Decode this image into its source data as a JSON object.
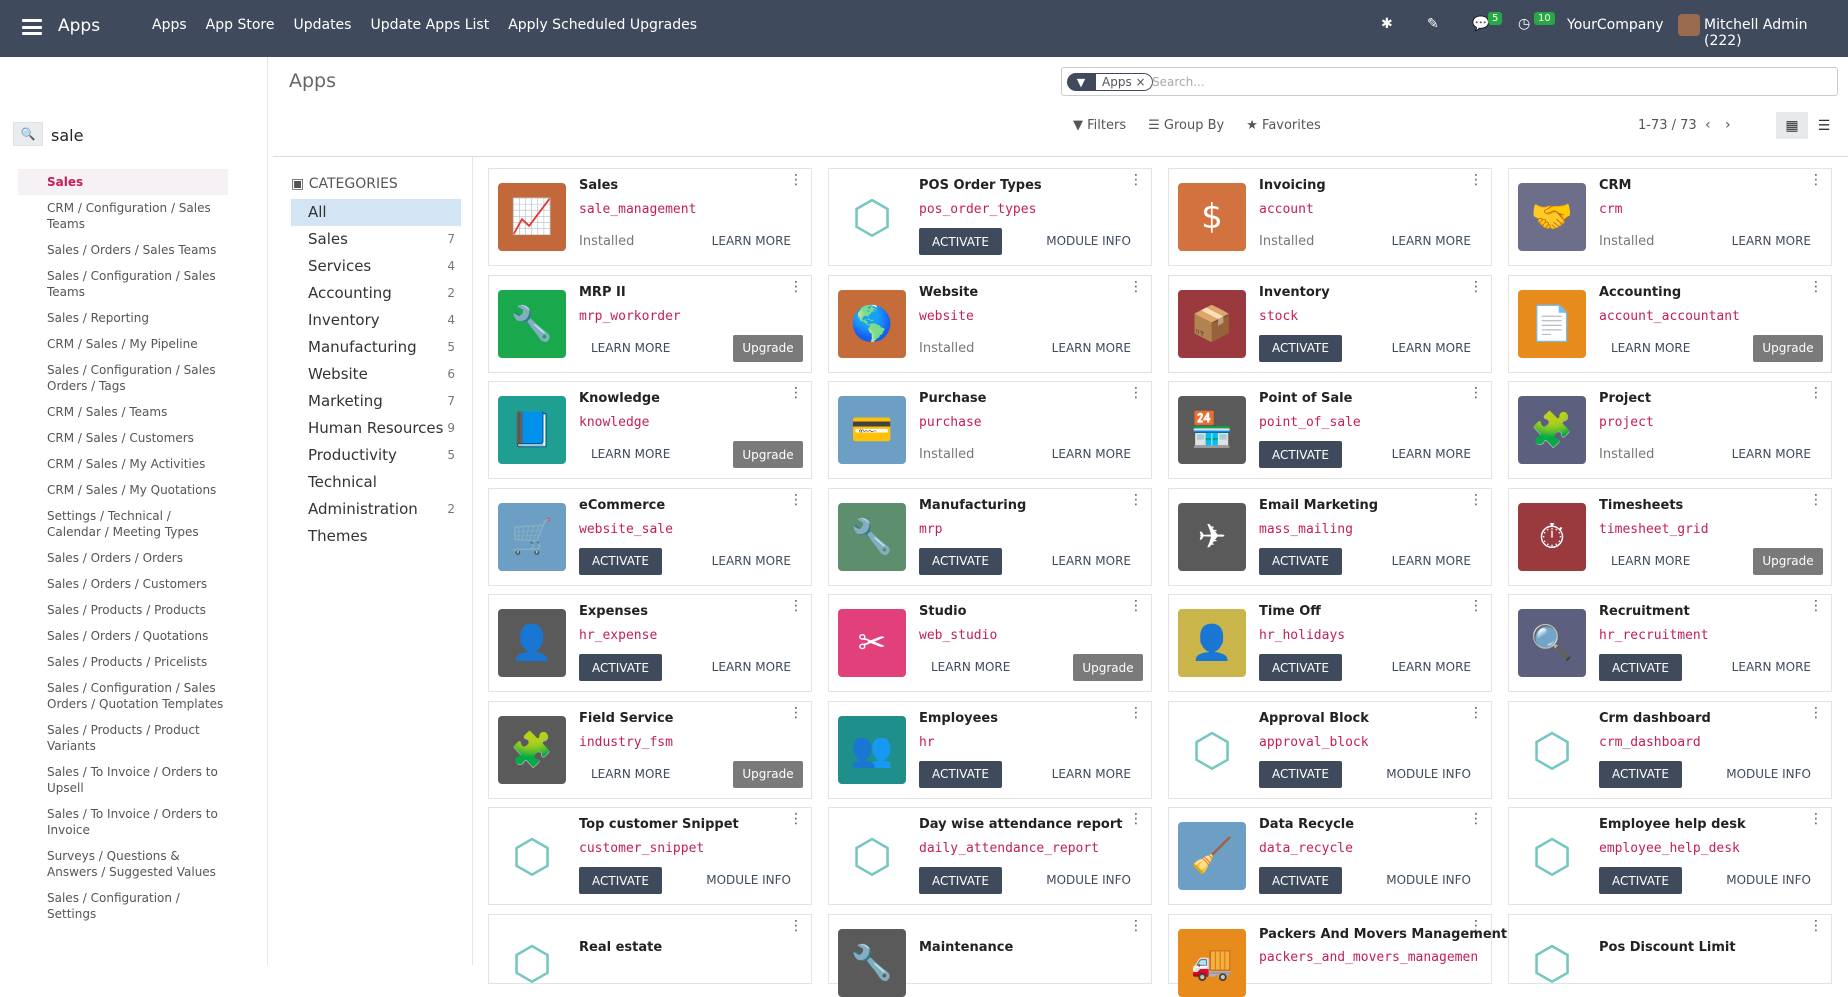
{
  "topbar": {
    "brand": "Apps",
    "menu": [
      "Apps",
      "App Store",
      "Updates",
      "Update Apps List",
      "Apply Scheduled Upgrades"
    ],
    "chat_count": "5",
    "activity_count": "10",
    "company": "YourCompany",
    "user": "Mitchell Admin (222)"
  },
  "sidepanel": {
    "search_value": "sale",
    "items": [
      "Sales",
      "CRM / Configuration / Sales Teams",
      "Sales / Orders / Sales Teams",
      "Sales / Configuration / Sales Teams",
      "Sales / Reporting",
      "CRM / Sales / My Pipeline",
      "Sales / Configuration / Sales Orders / Tags",
      "CRM / Sales / Teams",
      "CRM / Sales / Customers",
      "CRM / Sales / My Activities",
      "CRM / Sales / My Quotations",
      "Settings / Technical / Calendar / Meeting Types",
      "Sales / Orders / Orders",
      "Sales / Orders / Customers",
      "Sales / Products / Products",
      "Sales / Orders / Quotations",
      "Sales / Products / Pricelists",
      "Sales / Configuration / Sales Orders / Quotation Templates",
      "Sales / Products / Product Variants",
      "Sales / To Invoice / Orders to Upsell",
      "Sales / To Invoice / Orders to Invoice",
      "Surveys / Questions & Answers / Suggested Values",
      "Sales / Configuration / Settings"
    ]
  },
  "control": {
    "title": "Apps",
    "facet": "Apps",
    "search_placeholder": "Search...",
    "filters": "Filters",
    "group_by": "Group By",
    "favorites": "Favorites",
    "pager": "1-73 / 73"
  },
  "categories": {
    "heading": "CATEGORIES",
    "items": [
      {
        "label": "All",
        "count": ""
      },
      {
        "label": "Sales",
        "count": "7"
      },
      {
        "label": "Services",
        "count": "4"
      },
      {
        "label": "Accounting",
        "count": "2"
      },
      {
        "label": "Inventory",
        "count": "4"
      },
      {
        "label": "Manufacturing",
        "count": "5"
      },
      {
        "label": "Website",
        "count": "6"
      },
      {
        "label": "Marketing",
        "count": "7"
      },
      {
        "label": "Human Resources",
        "count": "9"
      },
      {
        "label": "Productivity",
        "count": "5"
      },
      {
        "label": "Technical",
        "count": ""
      },
      {
        "label": "Administration",
        "count": "2"
      },
      {
        "label": "Themes",
        "count": ""
      }
    ]
  },
  "labels": {
    "activate": "ACTIVATE",
    "learn_more": "LEARN MORE",
    "module_info": "MODULE INFO",
    "upgrade": "Upgrade",
    "installed": "Installed"
  },
  "apps": [
    {
      "name": "Sales",
      "tech": "sale_management",
      "state": "installed",
      "link": "LEARN MORE",
      "icon": "chart-up-icon",
      "color": "#c3683b",
      "glyph": "📈"
    },
    {
      "name": "POS Order Types",
      "tech": "pos_order_types",
      "state": "activate",
      "link": "MODULE INFO",
      "icon": "cube-icon",
      "color": "",
      "glyph": "⬡"
    },
    {
      "name": "Invoicing",
      "tech": "account",
      "state": "installed",
      "link": "LEARN MORE",
      "icon": "invoice-icon",
      "color": "#d2733f",
      "glyph": "$"
    },
    {
      "name": "CRM",
      "tech": "crm",
      "state": "installed",
      "link": "LEARN MORE",
      "icon": "handshake-icon",
      "color": "#6d6e8a",
      "glyph": "🤝"
    },
    {
      "name": "MRP II",
      "tech": "mrp_workorder",
      "state": "upgrade",
      "link": "LEARN MORE",
      "icon": "wrench-icon",
      "color": "#1aa84c",
      "glyph": "🔧"
    },
    {
      "name": "Website",
      "tech": "website",
      "state": "installed",
      "link": "LEARN MORE",
      "icon": "globe-icon",
      "color": "#c46d3a",
      "glyph": "🌎"
    },
    {
      "name": "Inventory",
      "tech": "stock",
      "state": "activate",
      "link": "LEARN MORE",
      "icon": "box-icon",
      "color": "#9a3a3e",
      "glyph": "📦"
    },
    {
      "name": "Accounting",
      "tech": "account_accountant",
      "state": "upgrade",
      "link": "LEARN MORE",
      "icon": "document-icon",
      "color": "#e88b1d",
      "glyph": "📄"
    },
    {
      "name": "Knowledge",
      "tech": "knowledge",
      "state": "upgrade",
      "link": "LEARN MORE",
      "icon": "book-icon",
      "color": "#1f9f91",
      "glyph": "📘"
    },
    {
      "name": "Purchase",
      "tech": "purchase",
      "state": "installed",
      "link": "LEARN MORE",
      "icon": "card-icon",
      "color": "#6d9ec4",
      "glyph": "💳"
    },
    {
      "name": "Point of Sale",
      "tech": "point_of_sale",
      "state": "activate",
      "link": "LEARN MORE",
      "icon": "store-icon",
      "color": "#5a5a5a",
      "glyph": "🏪"
    },
    {
      "name": "Project",
      "tech": "project",
      "state": "installed",
      "link": "LEARN MORE",
      "icon": "puzzle-icon",
      "color": "#5c5f7d",
      "glyph": "🧩"
    },
    {
      "name": "eCommerce",
      "tech": "website_sale",
      "state": "activate",
      "link": "LEARN MORE",
      "icon": "cart-icon",
      "color": "#6d9ec4",
      "glyph": "🛒"
    },
    {
      "name": "Manufacturing",
      "tech": "mrp",
      "state": "activate",
      "link": "LEARN MORE",
      "icon": "wrench-icon",
      "color": "#5d8f6e",
      "glyph": "🔧"
    },
    {
      "name": "Email Marketing",
      "tech": "mass_mailing",
      "state": "activate",
      "link": "LEARN MORE",
      "icon": "paper-plane-icon",
      "color": "#5a5a5a",
      "glyph": "✈"
    },
    {
      "name": "Timesheets",
      "tech": "timesheet_grid",
      "state": "upgrade",
      "link": "LEARN MORE",
      "icon": "stopwatch-icon",
      "color": "#9a3a3e",
      "glyph": "⏱"
    },
    {
      "name": "Expenses",
      "tech": "hr_expense",
      "state": "activate",
      "link": "LEARN MORE",
      "icon": "user-money-icon",
      "color": "#5a5a5a",
      "glyph": "👤"
    },
    {
      "name": "Studio",
      "tech": "web_studio",
      "state": "upgrade",
      "link": "LEARN MORE",
      "icon": "tools-icon",
      "color": "#e2407b",
      "glyph": "✂"
    },
    {
      "name": "Time Off",
      "tech": "hr_holidays",
      "state": "activate",
      "link": "LEARN MORE",
      "icon": "user-gear-icon",
      "color": "#c9b54a",
      "glyph": "👤"
    },
    {
      "name": "Recruitment",
      "tech": "hr_recruitment",
      "state": "activate",
      "link": "LEARN MORE",
      "icon": "magnifier-icon",
      "color": "#5c5f7d",
      "glyph": "🔍"
    },
    {
      "name": "Field Service",
      "tech": "industry_fsm",
      "state": "upgrade",
      "link": "LEARN MORE",
      "icon": "puzzle-clock-icon",
      "color": "#5a5a5a",
      "glyph": "🧩"
    },
    {
      "name": "Employees",
      "tech": "hr",
      "state": "activate",
      "link": "LEARN MORE",
      "icon": "users-icon",
      "color": "#1f8f8c",
      "glyph": "👥"
    },
    {
      "name": "Approval Block",
      "tech": "approval_block",
      "state": "activate",
      "link": "MODULE INFO",
      "icon": "cube-icon",
      "color": "",
      "glyph": "⬡"
    },
    {
      "name": "Crm dashboard",
      "tech": "crm_dashboard",
      "state": "activate",
      "link": "MODULE INFO",
      "icon": "cube-icon",
      "color": "",
      "glyph": "⬡"
    },
    {
      "name": "Top customer Snippet",
      "tech": "customer_snippet",
      "state": "activate",
      "link": "MODULE INFO",
      "icon": "cube-icon",
      "color": "",
      "glyph": "⬡"
    },
    {
      "name": "Day wise attendance report",
      "tech": "daily_attendance_report",
      "state": "activate",
      "link": "MODULE INFO",
      "icon": "cube-icon",
      "color": "",
      "glyph": "⬡"
    },
    {
      "name": "Data Recycle",
      "tech": "data_recycle",
      "state": "activate",
      "link": "MODULE INFO",
      "icon": "broom-icon",
      "color": "#6d9ec4",
      "glyph": "🧹"
    },
    {
      "name": "Employee help desk",
      "tech": "employee_help_desk",
      "state": "activate",
      "link": "MODULE INFO",
      "icon": "cube-icon",
      "color": "",
      "glyph": "⬡"
    },
    {
      "name": "Real estate",
      "tech": "",
      "state": "none",
      "link": "",
      "icon": "cube-icon",
      "color": "",
      "glyph": "⬡"
    },
    {
      "name": "Maintenance",
      "tech": "",
      "state": "none",
      "link": "",
      "icon": "wrench-icon",
      "color": "#5a5a5a",
      "glyph": "🔧"
    },
    {
      "name": "Packers And Movers Management",
      "tech": "packers_and_movers_managemen",
      "state": "none",
      "link": "",
      "icon": "truck-icon",
      "color": "#e88b1d",
      "glyph": "🚚"
    },
    {
      "name": "Pos Discount Limit",
      "tech": "",
      "state": "none",
      "link": "",
      "icon": "cube-icon",
      "color": "",
      "glyph": "⬡"
    }
  ]
}
